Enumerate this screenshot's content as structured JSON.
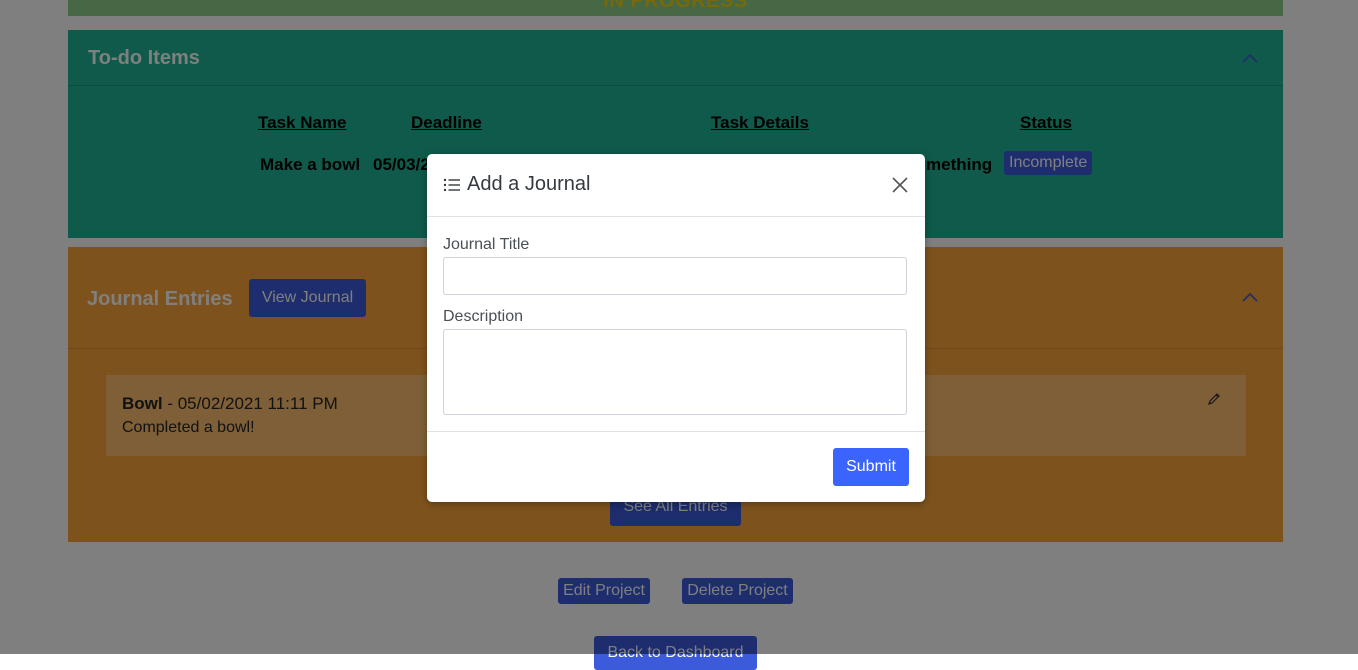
{
  "project_status": "IN PROGRESS",
  "todo": {
    "title": "To-do Items",
    "columns": [
      "Task Name",
      "Deadline",
      "Task Details",
      "Status"
    ],
    "rows": [
      {
        "task_name": "Make a bowl",
        "deadline": "05/03/2",
        "details": "mething",
        "status": "Incomplete"
      }
    ]
  },
  "journal": {
    "title": "Journal Entries",
    "view_button": "View Journal",
    "entries": [
      {
        "title": "Bowl",
        "timestamp": "- 05/02/2021 11:11 PM",
        "description": "Completed a bowl!"
      }
    ],
    "see_all_button": "See All Entries"
  },
  "footer": {
    "edit_button": "Edit Project",
    "delete_button": "Delete Project",
    "back_button": "Back to Dashboard"
  },
  "modal": {
    "title": "Add a Journal",
    "title_label": "Journal Title",
    "title_value": "",
    "description_label": "Description",
    "description_value": "",
    "submit_label": "Submit"
  },
  "icons": {
    "collapse": "chevron-up-icon",
    "edit": "pencil-icon",
    "list": "list-icon",
    "close": "close-icon"
  },
  "colors": {
    "todo_bg": "#1fb597",
    "journal_bg": "#fca43a",
    "status_bar": "#8ed18a",
    "primary": "#3b5bdb",
    "submit": "#3b64ff"
  }
}
